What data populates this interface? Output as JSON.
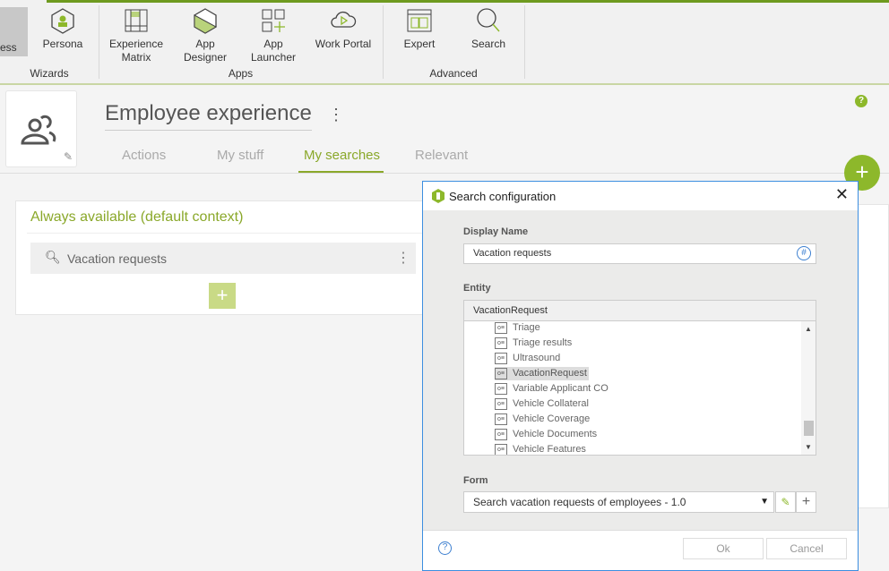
{
  "ribbon": {
    "items": [
      {
        "label": "ess",
        "icon": "process-icon"
      },
      {
        "label": "Persona",
        "icon": "persona-icon"
      },
      {
        "label": "Experience Matrix",
        "icon": "matrix-icon"
      },
      {
        "label": "App Designer",
        "icon": "app-designer-icon"
      },
      {
        "label": "App Launcher",
        "icon": "app-launcher-icon"
      },
      {
        "label": "Work Portal",
        "icon": "work-portal-icon"
      },
      {
        "label": "Expert",
        "icon": "expert-icon"
      },
      {
        "label": "Search",
        "icon": "search-icon"
      }
    ],
    "groups": [
      "Wizards",
      "Apps",
      "Advanced"
    ]
  },
  "header": {
    "title": "Employee experience",
    "tabs": [
      "Actions",
      "My stuff",
      "My searches",
      "Relevant"
    ],
    "active_tab": "My searches"
  },
  "card": {
    "title": "Always available (default context)",
    "items": [
      "Vacation requests"
    ]
  },
  "dialog": {
    "title": "Search configuration",
    "display_name_label": "Display Name",
    "display_name_value": "Vacation requests",
    "entity_label": "Entity",
    "entity_value": "VacationRequest",
    "entity_list": [
      "Triage",
      "Triage results",
      "Ultrasound",
      "VacationRequest",
      "Variable Applicant CO",
      "Vehicle Collateral",
      "Vehicle Coverage",
      "Vehicle Documents",
      "Vehicle Features"
    ],
    "entity_selected": "VacationRequest",
    "form_label": "Form",
    "form_value": "Search vacation requests of employees - 1.0",
    "ok": "Ok",
    "cancel": "Cancel"
  },
  "colors": {
    "accent": "#8db82b",
    "dialog_border": "#3c8ee0"
  }
}
